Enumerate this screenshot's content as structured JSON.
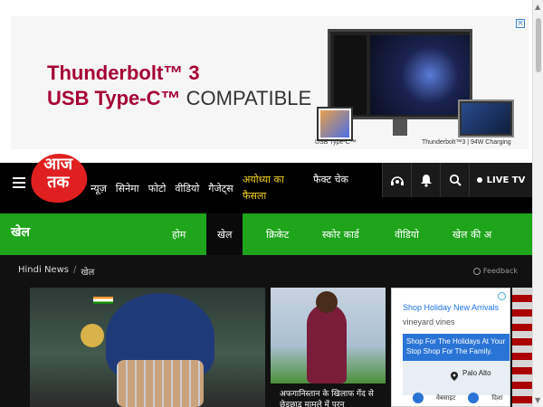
{
  "ad": {
    "headline_1": "Thunderbolt™ 3",
    "headline_2_bold": "USB Type-C™",
    "headline_2_light": " COMPATIBLE",
    "caption_left": "USB Type-C™",
    "caption_right": "Thunderbolt™3  |  94W Charging"
  },
  "header": {
    "logo_text": "आज तक",
    "nav": [
      "न्यूज़",
      "सिनेमा",
      "फोटो",
      "वीडियो",
      "गैजेट्स"
    ],
    "highlight": "अयोध्या का फैसला",
    "fact_check": "फैक्ट चेक",
    "live_tv": "LIVE TV",
    "icons": [
      "podcast-icon",
      "bell-icon",
      "search-icon"
    ]
  },
  "section": {
    "title": "खेल",
    "tabs": [
      {
        "label": "होम",
        "active": false
      },
      {
        "label": "खेल",
        "active": true
      },
      {
        "label": "क्रिकेट",
        "active": false
      },
      {
        "label": "स्कोर कार्ड",
        "active": false
      },
      {
        "label": "वीडियो",
        "active": false
      },
      {
        "label": "खेल की अ",
        "active": false
      }
    ]
  },
  "breadcrumb": {
    "home": "Hindi News",
    "separator": "/",
    "current": "खेल",
    "feedback": "Feedback"
  },
  "cards": {
    "card2_caption": "अफगानिस्तान के खिलाफ गेंद से छेड़छाड़ मामले में पूरन",
    "card3": {
      "title": "Shop Holiday New Arrivals",
      "subtitle": "vineyard vines",
      "blue_text": "Shop For The Holidays At Your Stop Shop For The Family.",
      "place": "Palo Alto",
      "btn1": "वेबसाइट",
      "btn2": "दिशा"
    }
  },
  "colors": {
    "brand_red": "#e02020",
    "section_green": "#1fa51c",
    "highlight_yellow": "#f5d21c",
    "ad_red": "#a50034"
  }
}
